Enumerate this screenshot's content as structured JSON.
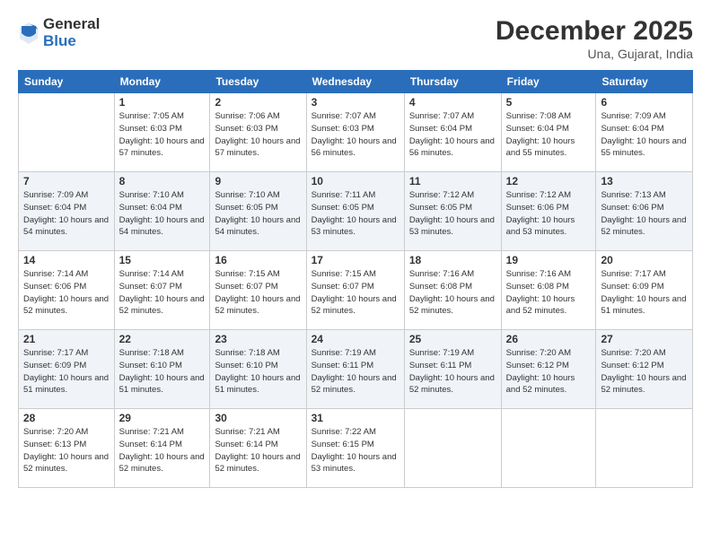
{
  "header": {
    "logo_general": "General",
    "logo_blue": "Blue",
    "month_year": "December 2025",
    "location": "Una, Gujarat, India"
  },
  "days_of_week": [
    "Sunday",
    "Monday",
    "Tuesday",
    "Wednesday",
    "Thursday",
    "Friday",
    "Saturday"
  ],
  "weeks": [
    [
      {
        "day": "",
        "sunrise": "",
        "sunset": "",
        "daylight": ""
      },
      {
        "day": "1",
        "sunrise": "Sunrise: 7:05 AM",
        "sunset": "Sunset: 6:03 PM",
        "daylight": "Daylight: 10 hours and 57 minutes."
      },
      {
        "day": "2",
        "sunrise": "Sunrise: 7:06 AM",
        "sunset": "Sunset: 6:03 PM",
        "daylight": "Daylight: 10 hours and 57 minutes."
      },
      {
        "day": "3",
        "sunrise": "Sunrise: 7:07 AM",
        "sunset": "Sunset: 6:03 PM",
        "daylight": "Daylight: 10 hours and 56 minutes."
      },
      {
        "day": "4",
        "sunrise": "Sunrise: 7:07 AM",
        "sunset": "Sunset: 6:04 PM",
        "daylight": "Daylight: 10 hours and 56 minutes."
      },
      {
        "day": "5",
        "sunrise": "Sunrise: 7:08 AM",
        "sunset": "Sunset: 6:04 PM",
        "daylight": "Daylight: 10 hours and 55 minutes."
      },
      {
        "day": "6",
        "sunrise": "Sunrise: 7:09 AM",
        "sunset": "Sunset: 6:04 PM",
        "daylight": "Daylight: 10 hours and 55 minutes."
      }
    ],
    [
      {
        "day": "7",
        "sunrise": "Sunrise: 7:09 AM",
        "sunset": "Sunset: 6:04 PM",
        "daylight": "Daylight: 10 hours and 54 minutes."
      },
      {
        "day": "8",
        "sunrise": "Sunrise: 7:10 AM",
        "sunset": "Sunset: 6:04 PM",
        "daylight": "Daylight: 10 hours and 54 minutes."
      },
      {
        "day": "9",
        "sunrise": "Sunrise: 7:10 AM",
        "sunset": "Sunset: 6:05 PM",
        "daylight": "Daylight: 10 hours and 54 minutes."
      },
      {
        "day": "10",
        "sunrise": "Sunrise: 7:11 AM",
        "sunset": "Sunset: 6:05 PM",
        "daylight": "Daylight: 10 hours and 53 minutes."
      },
      {
        "day": "11",
        "sunrise": "Sunrise: 7:12 AM",
        "sunset": "Sunset: 6:05 PM",
        "daylight": "Daylight: 10 hours and 53 minutes."
      },
      {
        "day": "12",
        "sunrise": "Sunrise: 7:12 AM",
        "sunset": "Sunset: 6:06 PM",
        "daylight": "Daylight: 10 hours and 53 minutes."
      },
      {
        "day": "13",
        "sunrise": "Sunrise: 7:13 AM",
        "sunset": "Sunset: 6:06 PM",
        "daylight": "Daylight: 10 hours and 52 minutes."
      }
    ],
    [
      {
        "day": "14",
        "sunrise": "Sunrise: 7:14 AM",
        "sunset": "Sunset: 6:06 PM",
        "daylight": "Daylight: 10 hours and 52 minutes."
      },
      {
        "day": "15",
        "sunrise": "Sunrise: 7:14 AM",
        "sunset": "Sunset: 6:07 PM",
        "daylight": "Daylight: 10 hours and 52 minutes."
      },
      {
        "day": "16",
        "sunrise": "Sunrise: 7:15 AM",
        "sunset": "Sunset: 6:07 PM",
        "daylight": "Daylight: 10 hours and 52 minutes."
      },
      {
        "day": "17",
        "sunrise": "Sunrise: 7:15 AM",
        "sunset": "Sunset: 6:07 PM",
        "daylight": "Daylight: 10 hours and 52 minutes."
      },
      {
        "day": "18",
        "sunrise": "Sunrise: 7:16 AM",
        "sunset": "Sunset: 6:08 PM",
        "daylight": "Daylight: 10 hours and 52 minutes."
      },
      {
        "day": "19",
        "sunrise": "Sunrise: 7:16 AM",
        "sunset": "Sunset: 6:08 PM",
        "daylight": "Daylight: 10 hours and 52 minutes."
      },
      {
        "day": "20",
        "sunrise": "Sunrise: 7:17 AM",
        "sunset": "Sunset: 6:09 PM",
        "daylight": "Daylight: 10 hours and 51 minutes."
      }
    ],
    [
      {
        "day": "21",
        "sunrise": "Sunrise: 7:17 AM",
        "sunset": "Sunset: 6:09 PM",
        "daylight": "Daylight: 10 hours and 51 minutes."
      },
      {
        "day": "22",
        "sunrise": "Sunrise: 7:18 AM",
        "sunset": "Sunset: 6:10 PM",
        "daylight": "Daylight: 10 hours and 51 minutes."
      },
      {
        "day": "23",
        "sunrise": "Sunrise: 7:18 AM",
        "sunset": "Sunset: 6:10 PM",
        "daylight": "Daylight: 10 hours and 51 minutes."
      },
      {
        "day": "24",
        "sunrise": "Sunrise: 7:19 AM",
        "sunset": "Sunset: 6:11 PM",
        "daylight": "Daylight: 10 hours and 52 minutes."
      },
      {
        "day": "25",
        "sunrise": "Sunrise: 7:19 AM",
        "sunset": "Sunset: 6:11 PM",
        "daylight": "Daylight: 10 hours and 52 minutes."
      },
      {
        "day": "26",
        "sunrise": "Sunrise: 7:20 AM",
        "sunset": "Sunset: 6:12 PM",
        "daylight": "Daylight: 10 hours and 52 minutes."
      },
      {
        "day": "27",
        "sunrise": "Sunrise: 7:20 AM",
        "sunset": "Sunset: 6:12 PM",
        "daylight": "Daylight: 10 hours and 52 minutes."
      }
    ],
    [
      {
        "day": "28",
        "sunrise": "Sunrise: 7:20 AM",
        "sunset": "Sunset: 6:13 PM",
        "daylight": "Daylight: 10 hours and 52 minutes."
      },
      {
        "day": "29",
        "sunrise": "Sunrise: 7:21 AM",
        "sunset": "Sunset: 6:14 PM",
        "daylight": "Daylight: 10 hours and 52 minutes."
      },
      {
        "day": "30",
        "sunrise": "Sunrise: 7:21 AM",
        "sunset": "Sunset: 6:14 PM",
        "daylight": "Daylight: 10 hours and 52 minutes."
      },
      {
        "day": "31",
        "sunrise": "Sunrise: 7:22 AM",
        "sunset": "Sunset: 6:15 PM",
        "daylight": "Daylight: 10 hours and 53 minutes."
      },
      {
        "day": "",
        "sunrise": "",
        "sunset": "",
        "daylight": ""
      },
      {
        "day": "",
        "sunrise": "",
        "sunset": "",
        "daylight": ""
      },
      {
        "day": "",
        "sunrise": "",
        "sunset": "",
        "daylight": ""
      }
    ]
  ]
}
